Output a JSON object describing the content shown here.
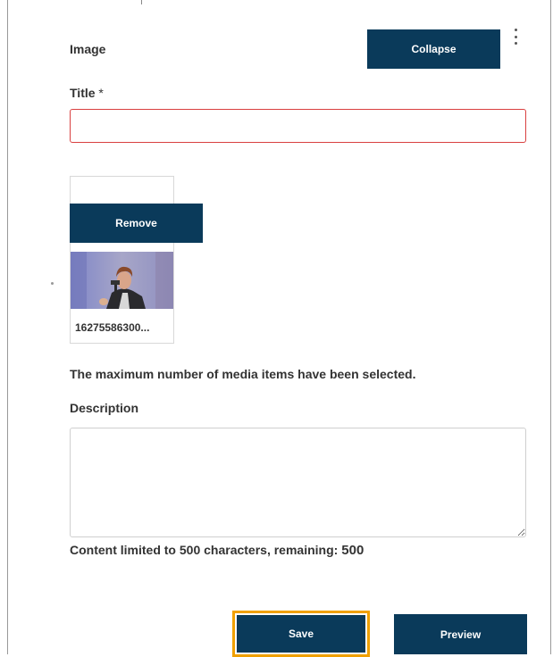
{
  "panel": {
    "section_label": "Image",
    "collapse_label": "Collapse",
    "title_label": "Title",
    "title_required_marker": "*",
    "title_value": "",
    "remove_label": "Remove",
    "media_filename": "16275586300...",
    "max_items_message": "The maximum number of media items have been selected.",
    "description_label": "Description",
    "description_value": "",
    "limit_text": "Content limited to 500 characters, remaining:",
    "limit_remaining": "500"
  },
  "actions": {
    "save_label": "Save",
    "preview_label": "Preview"
  },
  "colors": {
    "primary": "#0a3a5a",
    "focus_outline": "#f0a000",
    "error_border": "#d94040"
  },
  "icons": [
    "kebab-menu-icon",
    "resize-grip-icon"
  ]
}
